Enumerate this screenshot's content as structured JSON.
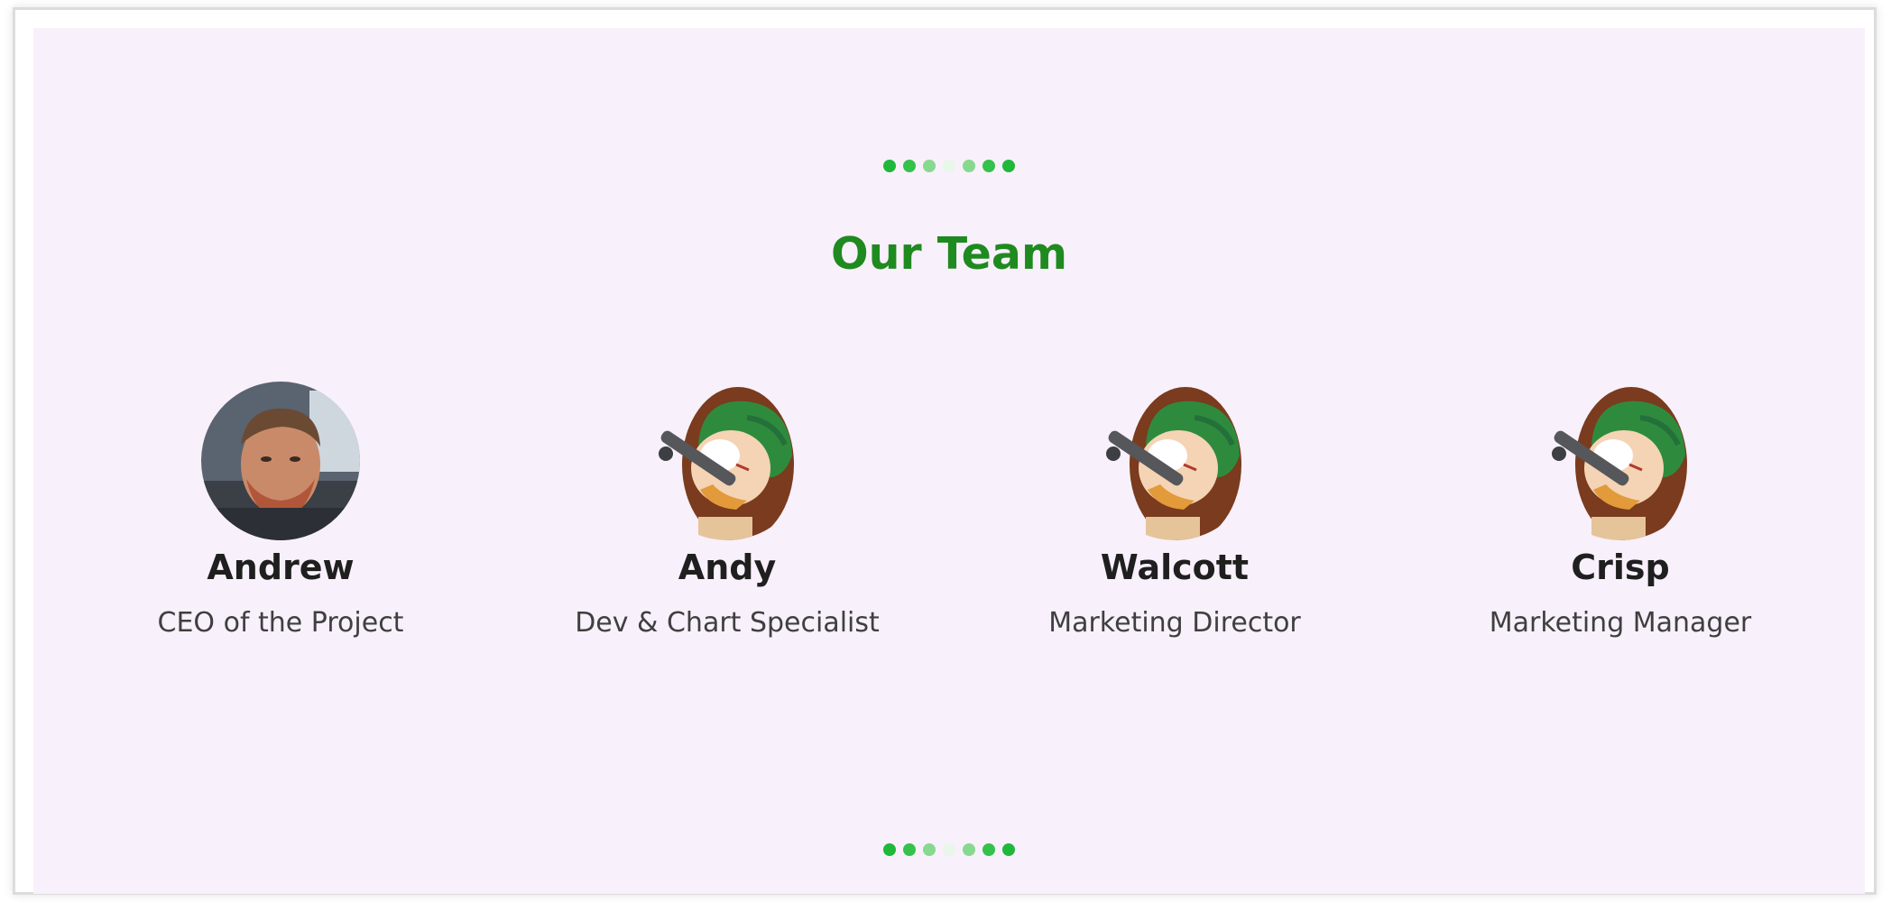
{
  "section": {
    "title": "Our Team",
    "dot_colors": [
      "#1fb83a",
      "#34c24a",
      "#86d98e",
      "#e9f6ea",
      "#86d98e",
      "#34c24a",
      "#1fb83a"
    ]
  },
  "members": [
    {
      "name": "Andrew",
      "role": "CEO of the Project",
      "avatar": "photo-avatar"
    },
    {
      "name": "Andy",
      "role": "Dev & Chart Specialist",
      "avatar": "soldier-cartoon-avatar"
    },
    {
      "name": "Walcott",
      "role": "Marketing Director",
      "avatar": "soldier-cartoon-avatar"
    },
    {
      "name": "Crisp",
      "role": "Marketing Manager",
      "avatar": "soldier-cartoon-avatar"
    }
  ],
  "colors": {
    "background": "#f8f0fa",
    "title": "#1f8a1f",
    "helmet": "#2e8b3d"
  }
}
